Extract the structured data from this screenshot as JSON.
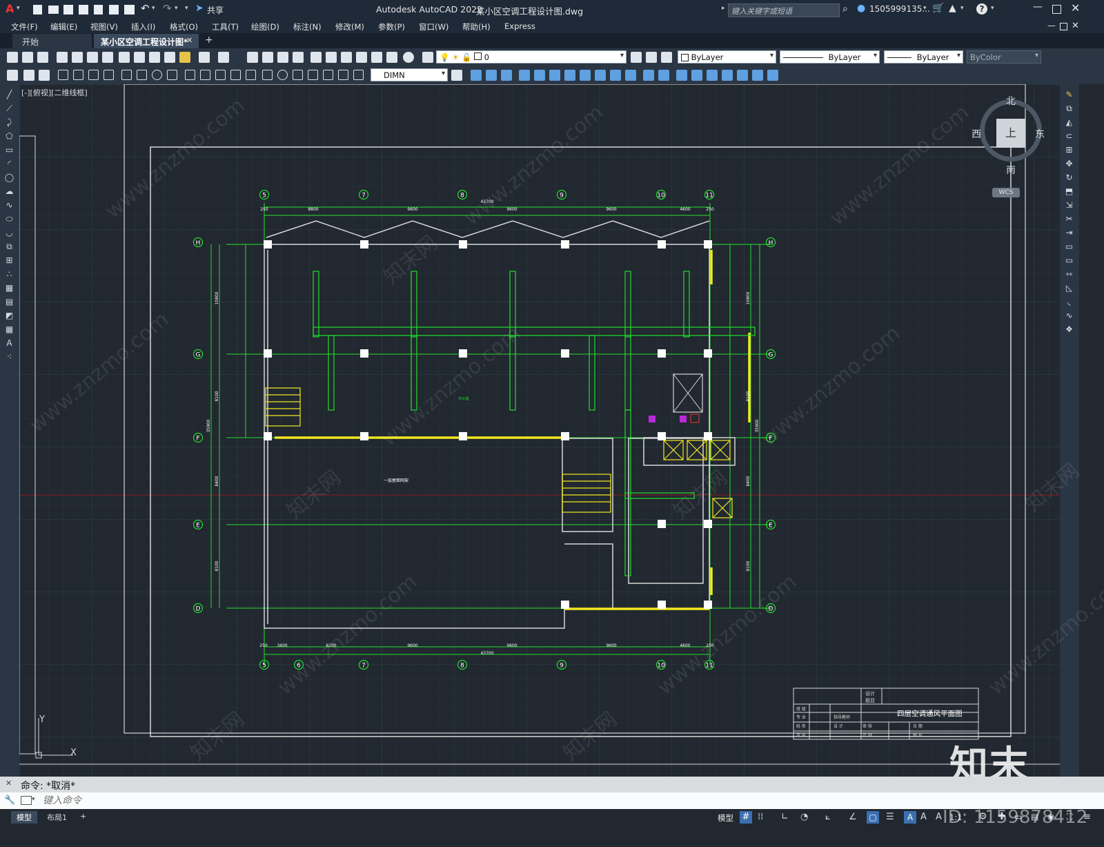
{
  "titlebar": {
    "logo": "A",
    "share": "共享",
    "app": "Autodesk AutoCAD 2022",
    "file": "某小区空调工程设计图.dwg",
    "search_placeholder": "键入关键字或短语",
    "user": "1505999135...",
    "help": "?"
  },
  "menus": [
    "文件(F)",
    "编辑(E)",
    "视图(V)",
    "插入(I)",
    "格式(O)",
    "工具(T)",
    "绘图(D)",
    "标注(N)",
    "修改(M)",
    "参数(P)",
    "窗口(W)",
    "帮助(H)",
    "Express"
  ],
  "tabs": {
    "start": "开始",
    "doc": "某小区空调工程设计图*",
    "close": "✕",
    "add": "+"
  },
  "layer": {
    "current": "0"
  },
  "props": {
    "color": "ByLayer",
    "linetype": "ByLayer",
    "lineweight": "ByLayer",
    "plotstyle": "ByColor"
  },
  "dimstyle": "DIMN",
  "viewport_label": "[-][俯视][二维线框]",
  "viewcube": {
    "north": "北",
    "south": "南",
    "east": "东",
    "west": "西",
    "top": "上",
    "wcs": "WCS"
  },
  "drawing": {
    "grid_top": [
      "5",
      "7",
      "8",
      "9",
      "10",
      "11"
    ],
    "grid_bottom": [
      "5",
      "6",
      "7",
      "8",
      "9",
      "10",
      "11"
    ],
    "grid_rows": [
      "H",
      "G",
      "F",
      "E",
      "D"
    ],
    "dims_top": [
      "250",
      "8800",
      "9600",
      "9600",
      "9600",
      "4600",
      "250"
    ],
    "dim_top_total": "43700",
    "dims_bottom": [
      "250",
      "3400",
      "6200",
      "9600",
      "9600",
      "9600",
      "4600",
      "250"
    ],
    "dim_bottom_total": "43700",
    "dims_left": [
      "10800",
      "8100",
      "8400",
      "8100"
    ],
    "dim_left_total": "35900",
    "dims_right": [
      "10800",
      "8100",
      "8400",
      "8100"
    ],
    "dim_right_total": "35900",
    "hall_label": "一层屋面网架",
    "room_label": "办公室"
  },
  "titleblock": {
    "design": "设计",
    "title": "题目",
    "drawing_name": "四层空调通风平面图",
    "rows": [
      "班 级",
      "专 业",
      "姓 名",
      "学 号"
    ],
    "mid": [
      "指导教师",
      "设 计",
      "审 核",
      "比 例"
    ],
    "right": [
      "日 期",
      "图 号"
    ]
  },
  "axis": {
    "y": "Y",
    "x": "X"
  },
  "command": {
    "history": "命令: *取消*",
    "input_placeholder": "键入命令"
  },
  "status": {
    "model_tab": "模型",
    "layout_tab": "布局1",
    "add": "+",
    "model_btn": "模型",
    "scale": "1:1"
  },
  "watermark": {
    "site": "www.znzmo.com",
    "brand": "知末网",
    "logo": "知末",
    "id": "ID: 1159878412"
  },
  "colors": {
    "accent": "#1e2a38",
    "canvas": "#212830",
    "grid_green": "#22e02a",
    "wall": "#d7d7d7",
    "yellow": "#f3e81f"
  }
}
